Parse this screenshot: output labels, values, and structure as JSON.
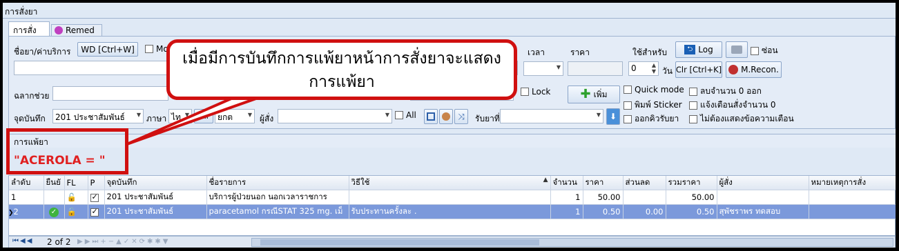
{
  "window": {
    "title": "การสั่งยา"
  },
  "tabs": [
    {
      "label": "การสั่งยา"
    },
    {
      "label": "Remed"
    }
  ],
  "form": {
    "drug_label": "ชื่อยา/ค่าบริการ",
    "wd_button": "WD [Ctrl+W]",
    "mo_label": "Mo",
    "time_label": "เวลา",
    "price_label": "ราคา",
    "use_for_label": "ใช้สำหรับ",
    "log_button": "Log",
    "hide_label": "ซ่อน",
    "days_value": "0",
    "days_label": "วัน",
    "clr_button": "Clr [Ctrl+K]",
    "mrecon_button": "M.Recon.",
    "label_help": "ฉลากช่วย",
    "lock_label": "Lock",
    "add_button": "เพิ่ม",
    "quick_mode": "Quick mode",
    "delete_zero": "ลบจำนวน 0 ออก",
    "print_sticker": "พิมพ์ Sticker",
    "warn_zero": "แจ้งเตือนสั่งจำนวน 0",
    "queue_label": "ออกคิวรับยา",
    "no_warning": "ไม่ต้องแสดงข้อความเตือน",
    "point_label": "จุดบันทึก",
    "point_value": "201 ประชาสัมพันธ์",
    "lang_label": "ภาษา",
    "lang_value": "ไท",
    "al_button": "All",
    "ya_value": "ยกต",
    "orderer_label": "ผู้สั่ง",
    "all_label": "All",
    "receive_label": "รับยาที่"
  },
  "callout": {
    "text": "เมื่อมีการบันทึกการแพ้ยาหน้าการสั่งยาจะแสดงการแพ้ยา"
  },
  "allergy": {
    "section_title": "การแพ้ยา",
    "value": "\"ACEROLA = \""
  },
  "grid": {
    "columns": [
      "ลำดับ",
      "ยืนยั",
      "FL",
      "P",
      "จุดบันทึก",
      "ชื่อรายการ",
      "วิธีใช้",
      "จำนวน",
      "ราคา",
      "ส่วนลด",
      "รวมราคา",
      "ผู้สั่ง",
      "หมายเหตุการสั่ง"
    ],
    "rows": [
      {
        "no": "1",
        "point": "201 ประชาสัมพันธ์",
        "item": "บริการผู้ป่วยนอก นอกเวลาราชการ",
        "usage": "",
        "qty": "1",
        "price": "50.00",
        "discount": "",
        "total": "50.00",
        "orderer": "",
        "note": ""
      },
      {
        "no": "2",
        "point": "201 ประชาสัมพันธ์",
        "item": "paracetamol กรณีSTAT 325 mg. เม็",
        "usage": "รับประทานครั้งละ .",
        "qty": "1",
        "price": "0.50",
        "discount": "0.00",
        "total": "0.50",
        "orderer": "สุพัชราพร ทดสอบ",
        "note": ""
      }
    ]
  },
  "nav": {
    "record_text": "2 of 2"
  },
  "colors": {
    "callout_border": "#d01010",
    "allergy_text": "#e02020",
    "selected_row": "#7b99db",
    "background": "#dfe9f5"
  }
}
